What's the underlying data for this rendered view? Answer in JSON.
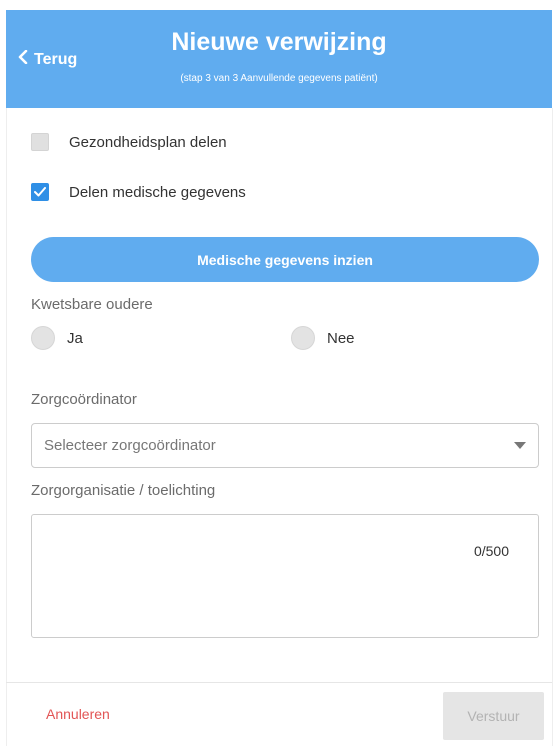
{
  "header": {
    "back_label": "Terug",
    "title": "Nieuwe verwijzing",
    "subtitle": "(stap 3 van 3 Aanvullende gegevens patiënt)",
    "background_color": "#60acef"
  },
  "options": [
    {
      "label": "Gezondheidsplan delen",
      "checked": false
    },
    {
      "label": "Delen medische gegevens",
      "checked": true
    }
  ],
  "medical_button_label": "Medische gegevens inzien",
  "vulnerable_elderly": {
    "label": "Kwetsbare oudere",
    "options": [
      {
        "label": "Ja",
        "selected": false
      },
      {
        "label": "Nee",
        "selected": false
      }
    ]
  },
  "care_coordinator": {
    "label": "Zorgcoördinator",
    "placeholder": "Selecteer zorgcoördinator"
  },
  "care_org": {
    "label": "Zorgorganisatie / toelichting",
    "counter": "0/500"
  },
  "footer": {
    "cancel_label": "Annuleren",
    "submit_label": "Verstuur",
    "cancel_color": "#e25555"
  }
}
